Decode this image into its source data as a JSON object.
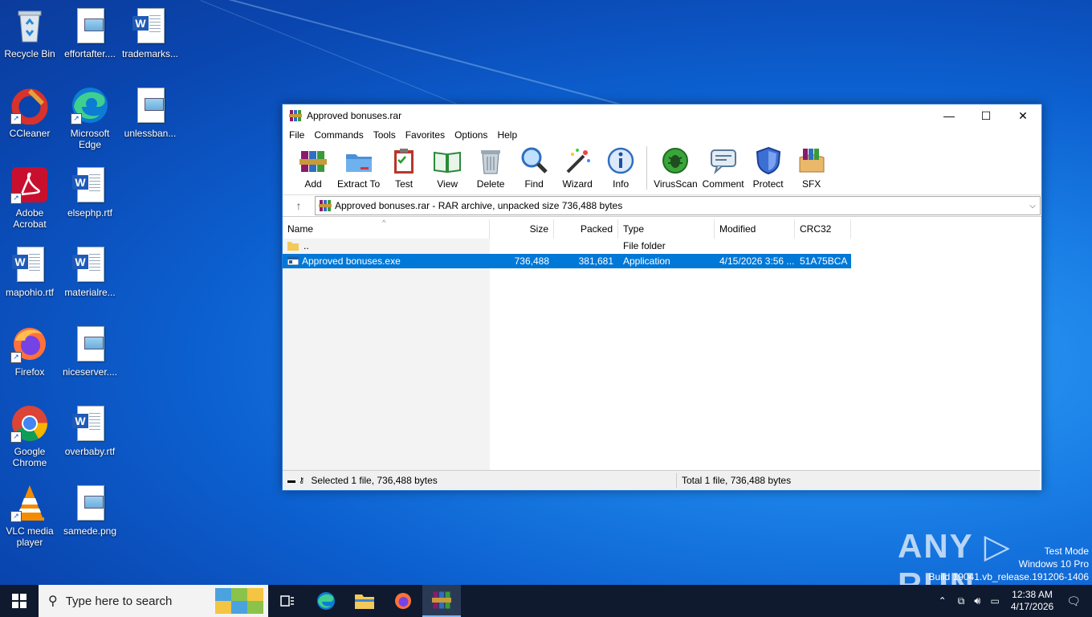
{
  "desktop": {
    "icons": [
      {
        "label": "Recycle Bin"
      },
      {
        "label": "effortafter...."
      },
      {
        "label": "trademarks..."
      },
      {
        "label": "CCleaner"
      },
      {
        "label": "Microsoft Edge"
      },
      {
        "label": "unlessban..."
      },
      {
        "label": "Adobe Acrobat"
      },
      {
        "label": "elsephp.rtf"
      },
      {
        "label": "mapohio.rtf"
      },
      {
        "label": "materialre..."
      },
      {
        "label": "Firefox"
      },
      {
        "label": "niceserver...."
      },
      {
        "label": "Google Chrome"
      },
      {
        "label": "overbaby.rtf"
      },
      {
        "label": "VLC media player"
      },
      {
        "label": "samede.png"
      }
    ]
  },
  "window": {
    "title": "Approved bonuses.rar",
    "menu": [
      "File",
      "Commands",
      "Tools",
      "Favorites",
      "Options",
      "Help"
    ],
    "toolbar": [
      "Add",
      "Extract To",
      "Test",
      "View",
      "Delete",
      "Find",
      "Wizard",
      "Info",
      "VirusScan",
      "Comment",
      "Protect",
      "SFX"
    ],
    "address": "Approved bonuses.rar - RAR archive, unpacked size 736,488 bytes",
    "columns": [
      "Name",
      "Size",
      "Packed",
      "Type",
      "Modified",
      "CRC32"
    ],
    "rows": [
      {
        "name": "..",
        "size": "",
        "packed": "",
        "type": "File folder",
        "modified": "",
        "crc": ""
      },
      {
        "name": "Approved bonuses.exe",
        "size": "736,488",
        "packed": "381,681",
        "type": "Application",
        "modified": "4/15/2026 3:56 ...",
        "crc": "51A75BCA"
      }
    ],
    "status_left": "Selected 1 file, 736,488 bytes",
    "status_right": "Total 1 file, 736,488 bytes"
  },
  "taskbar": {
    "search_placeholder": "Type here to search",
    "time": "12:38 AM",
    "date": "4/17/2026"
  },
  "watermark": {
    "line1": "Test Mode",
    "line2": "Windows 10 Pro",
    "line3": "Build 19041.vb_release.191206-1406",
    "brand": "ANY RUN"
  },
  "colors": {
    "selection": "#0078d7",
    "taskbar": "#0f1a2e",
    "window_border": "#2b79d8"
  }
}
